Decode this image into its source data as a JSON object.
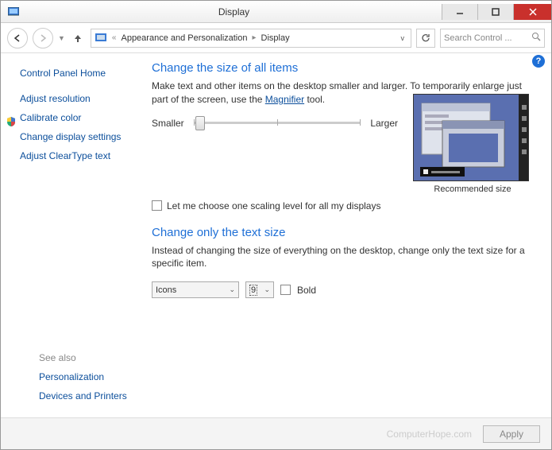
{
  "window": {
    "title": "Display"
  },
  "nav": {
    "breadcrumb1": "Appearance and Personalization",
    "breadcrumb2": "Display",
    "search_placeholder": "Search Control ..."
  },
  "sidebar": {
    "home": "Control Panel Home",
    "links": {
      "resolution": "Adjust resolution",
      "calibrate": "Calibrate color",
      "settings": "Change display settings",
      "cleartype": "Adjust ClearType text"
    },
    "seealso_hdr": "See also",
    "seealso": {
      "personalization": "Personalization",
      "devices": "Devices and Printers"
    }
  },
  "main": {
    "heading1": "Change the size of all items",
    "desc1a": "Make text and other items on the desktop smaller and larger. To temporarily enlarge just part of the screen, use the ",
    "magnifier": "Magnifier",
    "desc1b": " tool.",
    "smaller": "Smaller",
    "larger": "Larger",
    "recommended": "Recommended size",
    "scaling_cb": "Let me choose one scaling level for all my displays",
    "heading2": "Change only the text size",
    "desc2": "Instead of changing the size of everything on the desktop, change only the text size for a specific item.",
    "item_select": "Icons",
    "size_select": "9",
    "bold": "Bold"
  },
  "footer": {
    "watermark": "ComputerHope.com",
    "apply": "Apply"
  }
}
